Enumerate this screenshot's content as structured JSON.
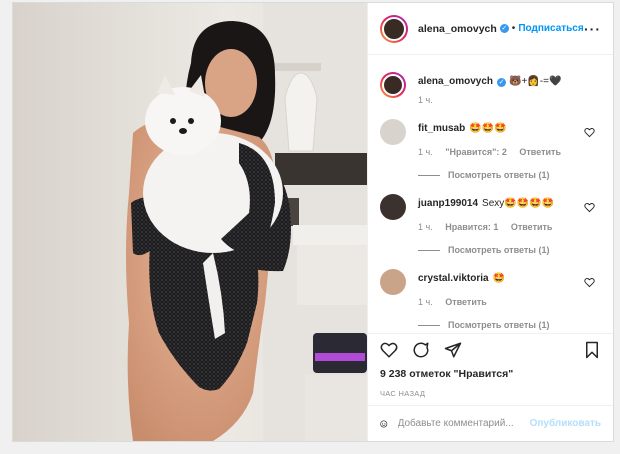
{
  "post": {
    "author": {
      "username": "alena_omovych",
      "verified": true,
      "follow_label": "Подписаться",
      "separator": "•"
    },
    "caption": {
      "username": "alena_omovych",
      "text": "🐻+👩-=🖤",
      "time": "1 ч."
    },
    "comments": [
      {
        "username": "fit_musab",
        "text": "🤩🤩🤩",
        "time": "1 ч.",
        "likes_label": "\"Нравится\": 2",
        "reply_label": "Ответить",
        "view_replies": "Посмотреть ответы (1)"
      },
      {
        "username": "juanp199014",
        "text": "Sexy🤩🤩🤩🤩",
        "time": "1 ч.",
        "likes_label": "Нравится: 1",
        "reply_label": "Ответить",
        "view_replies": "Посмотреть ответы (1)"
      },
      {
        "username": "crystal.viktoria",
        "text": "🤩",
        "time": "1 ч.",
        "reply_label": "Ответить",
        "view_replies": "Посмотреть ответы (1)"
      }
    ],
    "likes_text": "9 238 отметок \"Нравится\"",
    "time_ago": "ЧАС НАЗАД",
    "add_comment": {
      "placeholder": "Добавьте комментарий...",
      "publish_label": "Опубликовать"
    },
    "icons": [
      "heart-icon",
      "comment-icon",
      "share-icon",
      "bookmark-icon",
      "emoji-icon",
      "more-icon"
    ],
    "colors": {
      "link_blue": "#0095f6",
      "publish_disabled": "#b2dffc",
      "verified_blue": "#3897f0",
      "muted_text": "#8e8e8e"
    }
  }
}
